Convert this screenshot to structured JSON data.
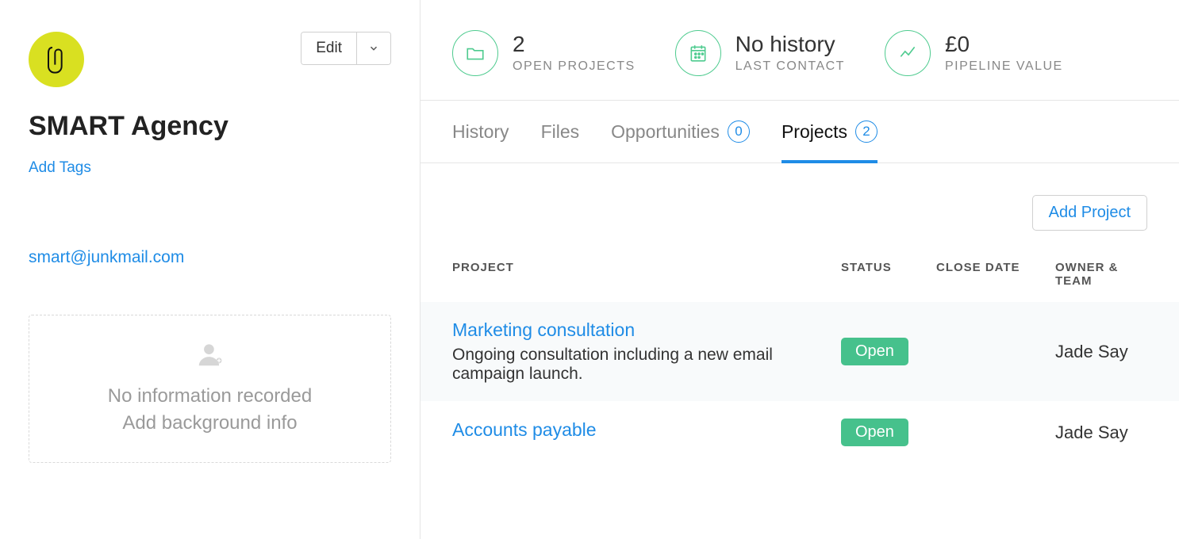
{
  "sidebar": {
    "edit_label": "Edit",
    "company_name": "SMART Agency",
    "add_tags_label": "Add Tags",
    "email": "smart@junkmail.com",
    "no_info_text": "No information recorded",
    "add_bg_text": "Add background info"
  },
  "stats": {
    "open_projects_value": "2",
    "open_projects_label": "OPEN PROJECTS",
    "last_contact_value": "No history",
    "last_contact_label": "LAST CONTACT",
    "pipeline_value": "£0",
    "pipeline_label": "PIPELINE VALUE"
  },
  "tabs": {
    "history": "History",
    "files": "Files",
    "opportunities": "Opportunities",
    "opportunities_count": "0",
    "projects": "Projects",
    "projects_count": "2"
  },
  "actions": {
    "add_project": "Add Project"
  },
  "table": {
    "headers": {
      "project": "PROJECT",
      "status": "STATUS",
      "close_date": "CLOSE DATE",
      "owner": "OWNER & TEAM"
    },
    "rows": [
      {
        "name": "Marketing consultation",
        "desc": "Ongoing consultation including a new email campaign launch.",
        "status": "Open",
        "close_date": "",
        "owner": "Jade Say"
      },
      {
        "name": "Accounts payable",
        "desc": "",
        "status": "Open",
        "close_date": "",
        "owner": "Jade Say"
      }
    ]
  }
}
